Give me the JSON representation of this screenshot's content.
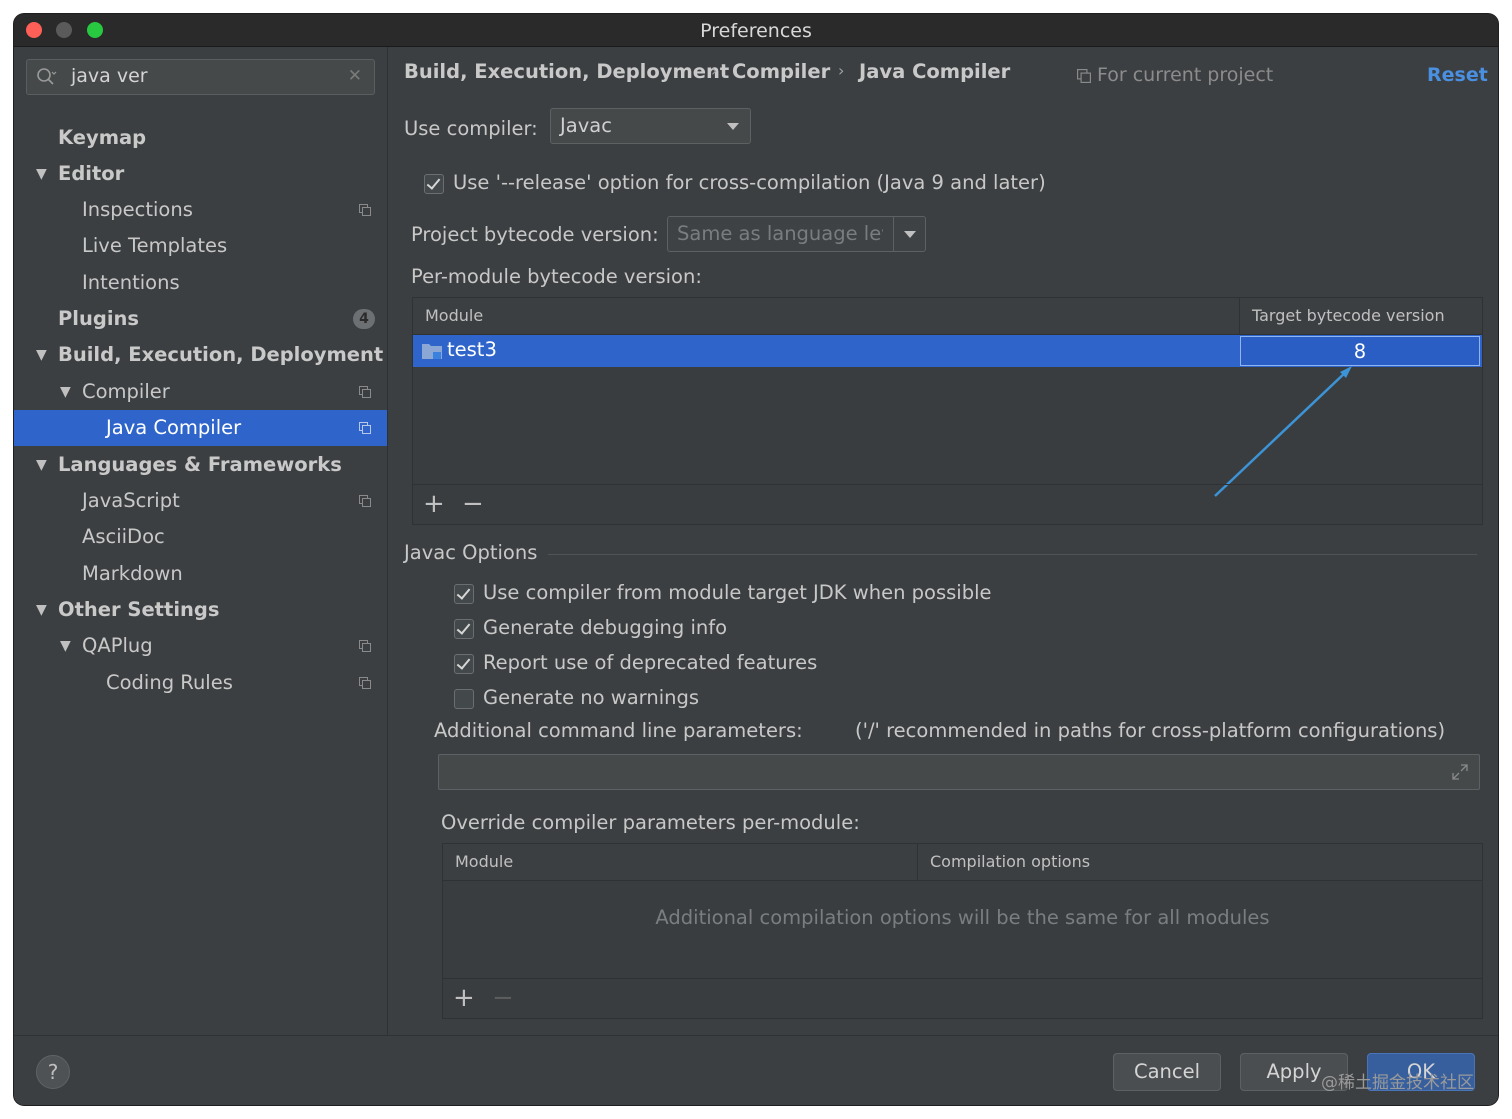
{
  "window": {
    "title": "Preferences"
  },
  "search": {
    "value": "java ver"
  },
  "sidebar": {
    "items": [
      {
        "label": "Keymap"
      },
      {
        "label": "Editor"
      },
      {
        "label": "Inspections"
      },
      {
        "label": "Live Templates"
      },
      {
        "label": "Intentions"
      },
      {
        "label": "Plugins",
        "badge": "4"
      },
      {
        "label": "Build, Execution, Deployment"
      },
      {
        "label": "Compiler"
      },
      {
        "label": "Java Compiler"
      },
      {
        "label": "Languages & Frameworks"
      },
      {
        "label": "JavaScript"
      },
      {
        "label": "AsciiDoc"
      },
      {
        "label": "Markdown"
      },
      {
        "label": "Other Settings"
      },
      {
        "label": "QAPlug"
      },
      {
        "label": "Coding Rules"
      }
    ]
  },
  "breadcrumb": {
    "items": [
      "Build, Execution, Deployment",
      "Compiler",
      "Java Compiler"
    ],
    "separator": "›"
  },
  "header": {
    "scope": "For current project",
    "reset": "Reset"
  },
  "compiler": {
    "use_label": "Use compiler:",
    "use_value": "Javac",
    "release_option": "Use '--release' option for cross-compilation (Java 9 and later)",
    "bytecode_label": "Project bytecode version:",
    "bytecode_value": "Same as language leve",
    "per_module_label": "Per-module bytecode version:"
  },
  "bytecode_table": {
    "headers": [
      "Module",
      "Target bytecode version"
    ],
    "rows": [
      {
        "module": "test3",
        "target": "8"
      }
    ],
    "add": "+",
    "remove": "−"
  },
  "javac": {
    "title": "Javac Options",
    "options": [
      {
        "label": "Use compiler from module target JDK when possible",
        "checked": true
      },
      {
        "label": "Generate debugging info",
        "checked": true
      },
      {
        "label": "Report use of deprecated features",
        "checked": true
      },
      {
        "label": "Generate no warnings",
        "checked": false
      }
    ],
    "params_label": "Additional command line parameters:",
    "params_hint": "('/' recommended in paths for cross-platform configurations)",
    "override_label": "Override compiler parameters per-module:"
  },
  "override_table": {
    "headers": [
      "Module",
      "Compilation options"
    ],
    "empty_text": "Additional compilation options will be the same for all modules",
    "add": "+",
    "remove": "−"
  },
  "buttons": {
    "help": "?",
    "cancel": "Cancel",
    "apply": "Apply",
    "ok": "OK"
  },
  "watermark": "@稀土掘金技术社区",
  "colors": {
    "selection": "#2f65ca",
    "accent": "#4a90e2",
    "background": "#3c3f41"
  }
}
